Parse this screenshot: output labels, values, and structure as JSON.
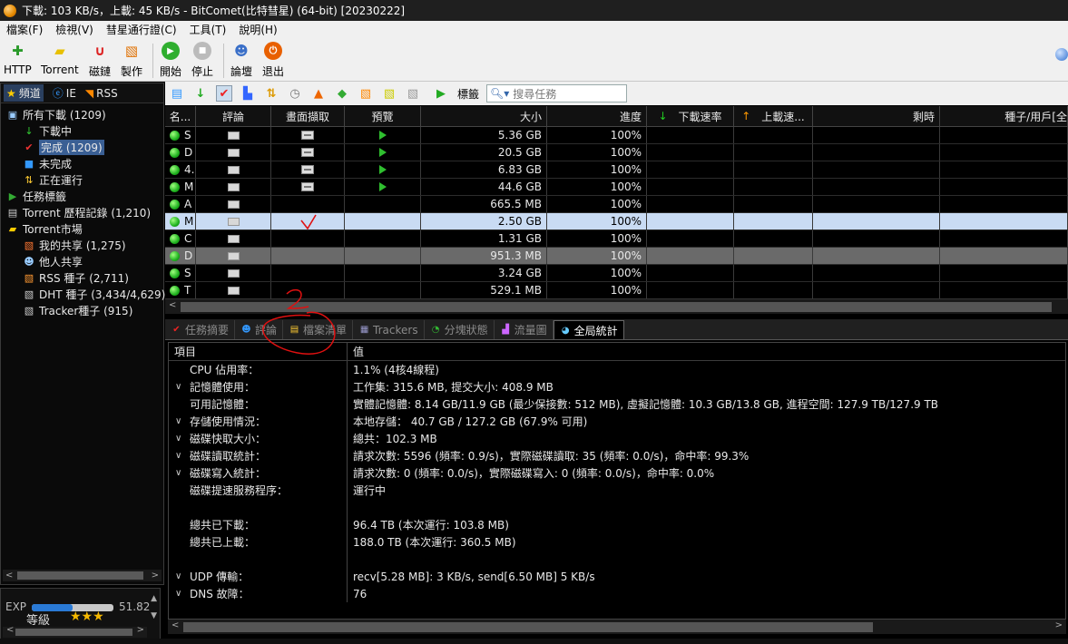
{
  "window": {
    "title": "下載: 103 KB/s，上載: 45 KB/s - BitComet(比特彗星) (64-bit) [20230222]"
  },
  "menu": [
    "檔案(F)",
    "檢視(V)",
    "彗星通行證(C)",
    "工具(T)",
    "說明(H)"
  ],
  "toolbar": {
    "buttons": [
      {
        "label": "HTTP",
        "icon": "http-add-icon",
        "color": "#2a9a2a"
      },
      {
        "label": "Torrent",
        "icon": "torrent-add-icon",
        "color": "#e8c000"
      },
      {
        "label": "磁鏈",
        "icon": "magnet-icon",
        "color": "#d22"
      },
      {
        "label": "製作",
        "icon": "make-torrent-icon",
        "color": "#e07000"
      },
      {
        "label": "開始",
        "icon": "start-icon",
        "color": "#2fae2f"
      },
      {
        "label": "停止",
        "icon": "stop-icon",
        "color": "#999"
      },
      {
        "label": "論壇",
        "icon": "forum-icon",
        "color": "#3a6fc8"
      },
      {
        "label": "退出",
        "icon": "exit-icon",
        "color": "#e86000"
      }
    ]
  },
  "left": {
    "tabs": [
      "頻道",
      "IE",
      "RSS"
    ],
    "tree": [
      {
        "label": "所有下載 (1209)",
        "indent": 0,
        "icon": "all-downloads-icon",
        "glyph": "▣",
        "color": "#9cf"
      },
      {
        "label": "下載中",
        "indent": 1,
        "icon": "downloading-icon",
        "glyph": "↓",
        "color": "#3c3"
      },
      {
        "label": "完成 (1209)",
        "indent": 1,
        "icon": "completed-icon",
        "glyph": "✔",
        "color": "#e33",
        "selected": true
      },
      {
        "label": "未完成",
        "indent": 1,
        "icon": "incomplete-icon",
        "glyph": "■",
        "color": "#39f"
      },
      {
        "label": "正在運行",
        "indent": 1,
        "icon": "running-icon",
        "glyph": "⇅",
        "color": "#fc3"
      },
      {
        "label": "任務標籤",
        "indent": 0,
        "icon": "task-tag-icon",
        "glyph": "▶",
        "color": "#3a3"
      },
      {
        "label": "Torrent 歷程記錄 (1,210)",
        "indent": 0,
        "icon": "torrent-history-icon",
        "glyph": "▤",
        "color": "#ccc"
      },
      {
        "label": "Torrent市場",
        "indent": 0,
        "icon": "torrent-market-icon",
        "glyph": "▰",
        "color": "#fc0"
      },
      {
        "label": "我的共享 (1,275)",
        "indent": 1,
        "icon": "my-share-icon",
        "glyph": "▧",
        "color": "#f73"
      },
      {
        "label": "他人共享",
        "indent": 1,
        "icon": "others-share-icon",
        "glyph": "☻",
        "color": "#9cf"
      },
      {
        "label": "RSS 種子 (2,711)",
        "indent": 1,
        "icon": "rss-seed-icon",
        "glyph": "▧",
        "color": "#f93"
      },
      {
        "label": "DHT 種子 (3,434/4,629)",
        "indent": 1,
        "icon": "dht-seed-icon",
        "glyph": "▧",
        "color": "#ccc"
      },
      {
        "label": "Tracker種子 (915)",
        "indent": 1,
        "icon": "tracker-seed-icon",
        "glyph": "▧",
        "color": "#ccc"
      }
    ],
    "exp": {
      "label": "EXP",
      "value": "51.82",
      "level_label": "等級",
      "stars": "★★★",
      "progress": 0.5
    }
  },
  "tasks": {
    "search_placeholder": "搜尋任務",
    "tag_label": "標籤",
    "columns": [
      "名...",
      "評論",
      "畫面擷取",
      "預覽",
      "大小",
      "進度",
      "下載速率",
      "上載速...",
      "剩時",
      "種子/用戶[全"
    ],
    "rows": [
      {
        "name": "S",
        "shot": true,
        "preview": true,
        "size": "5.36 GB",
        "progress": "100%"
      },
      {
        "name": "D",
        "shot": true,
        "preview": true,
        "size": "20.5 GB",
        "progress": "100%"
      },
      {
        "name": "4.",
        "shot": true,
        "preview": true,
        "size": "6.83 GB",
        "progress": "100%"
      },
      {
        "name": "M",
        "shot": true,
        "preview": true,
        "size": "44.6 GB",
        "progress": "100%"
      },
      {
        "name": "A",
        "shot": false,
        "preview": false,
        "size": "665.5 MB",
        "progress": "100%"
      },
      {
        "name": "M",
        "shot": false,
        "preview": false,
        "size": "2.50 GB",
        "progress": "100%",
        "selected": true
      },
      {
        "name": "C",
        "shot": false,
        "preview": false,
        "size": "1.31 GB",
        "progress": "100%"
      },
      {
        "name": "D",
        "shot": false,
        "preview": false,
        "size": "951.3 MB",
        "progress": "100%",
        "gray": true
      },
      {
        "name": "S",
        "shot": false,
        "preview": false,
        "size": "3.24 GB",
        "progress": "100%"
      },
      {
        "name": "T",
        "shot": false,
        "preview": false,
        "size": "529.1 MB",
        "progress": "100%"
      }
    ]
  },
  "bottom_tabs": [
    {
      "label": "任務摘要",
      "icon": "summary-icon"
    },
    {
      "label": "評論",
      "icon": "comments-icon"
    },
    {
      "label": "檔案清單",
      "icon": "file-list-icon"
    },
    {
      "label": "Trackers",
      "icon": "trackers-icon"
    },
    {
      "label": "分塊狀態",
      "icon": "pieces-icon"
    },
    {
      "label": "流量圖",
      "icon": "traffic-graph-icon"
    },
    {
      "label": "全局統計",
      "icon": "global-stats-icon",
      "active": true
    }
  ],
  "stats": {
    "header": {
      "item": "項目",
      "value": "值"
    },
    "rows": [
      {
        "k": "CPU 佔用率：",
        "v": "1.1% (4核4線程)",
        "tg": ""
      },
      {
        "k": "記憶體使用：",
        "v": "工作集: 315.6 MB, 提交大小: 408.9 MB",
        "tg": "∨"
      },
      {
        "k": "可用記憶體：",
        "v": "實體記憶體: 8.14 GB/11.9 GB (最少保接數: 512 MB), 虛擬記憶體: 10.3 GB/13.8 GB, 進程空間: 127.9 TB/127.9 TB",
        "tg": ""
      },
      {
        "k": "存儲使用情況：",
        "v": "本地存儲： 40.7 GB / 127.2 GB (67.9% 可用)",
        "tg": "∨"
      },
      {
        "k": "磁碟快取大小：",
        "v": "總共：102.3 MB",
        "tg": "∨"
      },
      {
        "k": "磁碟讀取統計：",
        "v": "請求次數: 5596 (頻率: 0.9/s)，實際磁碟讀取: 35 (頻率: 0.0/s)，命中率: 99.3%",
        "tg": "∨"
      },
      {
        "k": "磁碟寫入統計：",
        "v": "請求次數: 0 (頻率: 0.0/s)，實際磁碟寫入: 0 (頻率: 0.0/s)，命中率: 0.0%",
        "tg": "∨"
      },
      {
        "k": "磁碟提速服務程序：",
        "v": "運行中",
        "tg": ""
      },
      {
        "k": "",
        "v": "",
        "tg": ""
      },
      {
        "k": "總共已下載：",
        "v": "96.4 TB (本次運行: 103.8 MB)",
        "tg": ""
      },
      {
        "k": "總共已上載：",
        "v": "188.0 TB (本次運行: 360.5 MB)",
        "tg": ""
      },
      {
        "k": "",
        "v": "",
        "tg": ""
      },
      {
        "k": "UDP 傳輸：",
        "v": "recv[5.28 MB]: 3 KB/s, send[6.50 MB] 5 KB/s",
        "tg": "∨"
      },
      {
        "k": "DNS 故障：",
        "v": "76",
        "tg": "∨"
      }
    ]
  },
  "annotations": {
    "check_mark": "✓",
    "scribble_number": "2",
    "color": "#e01010"
  }
}
